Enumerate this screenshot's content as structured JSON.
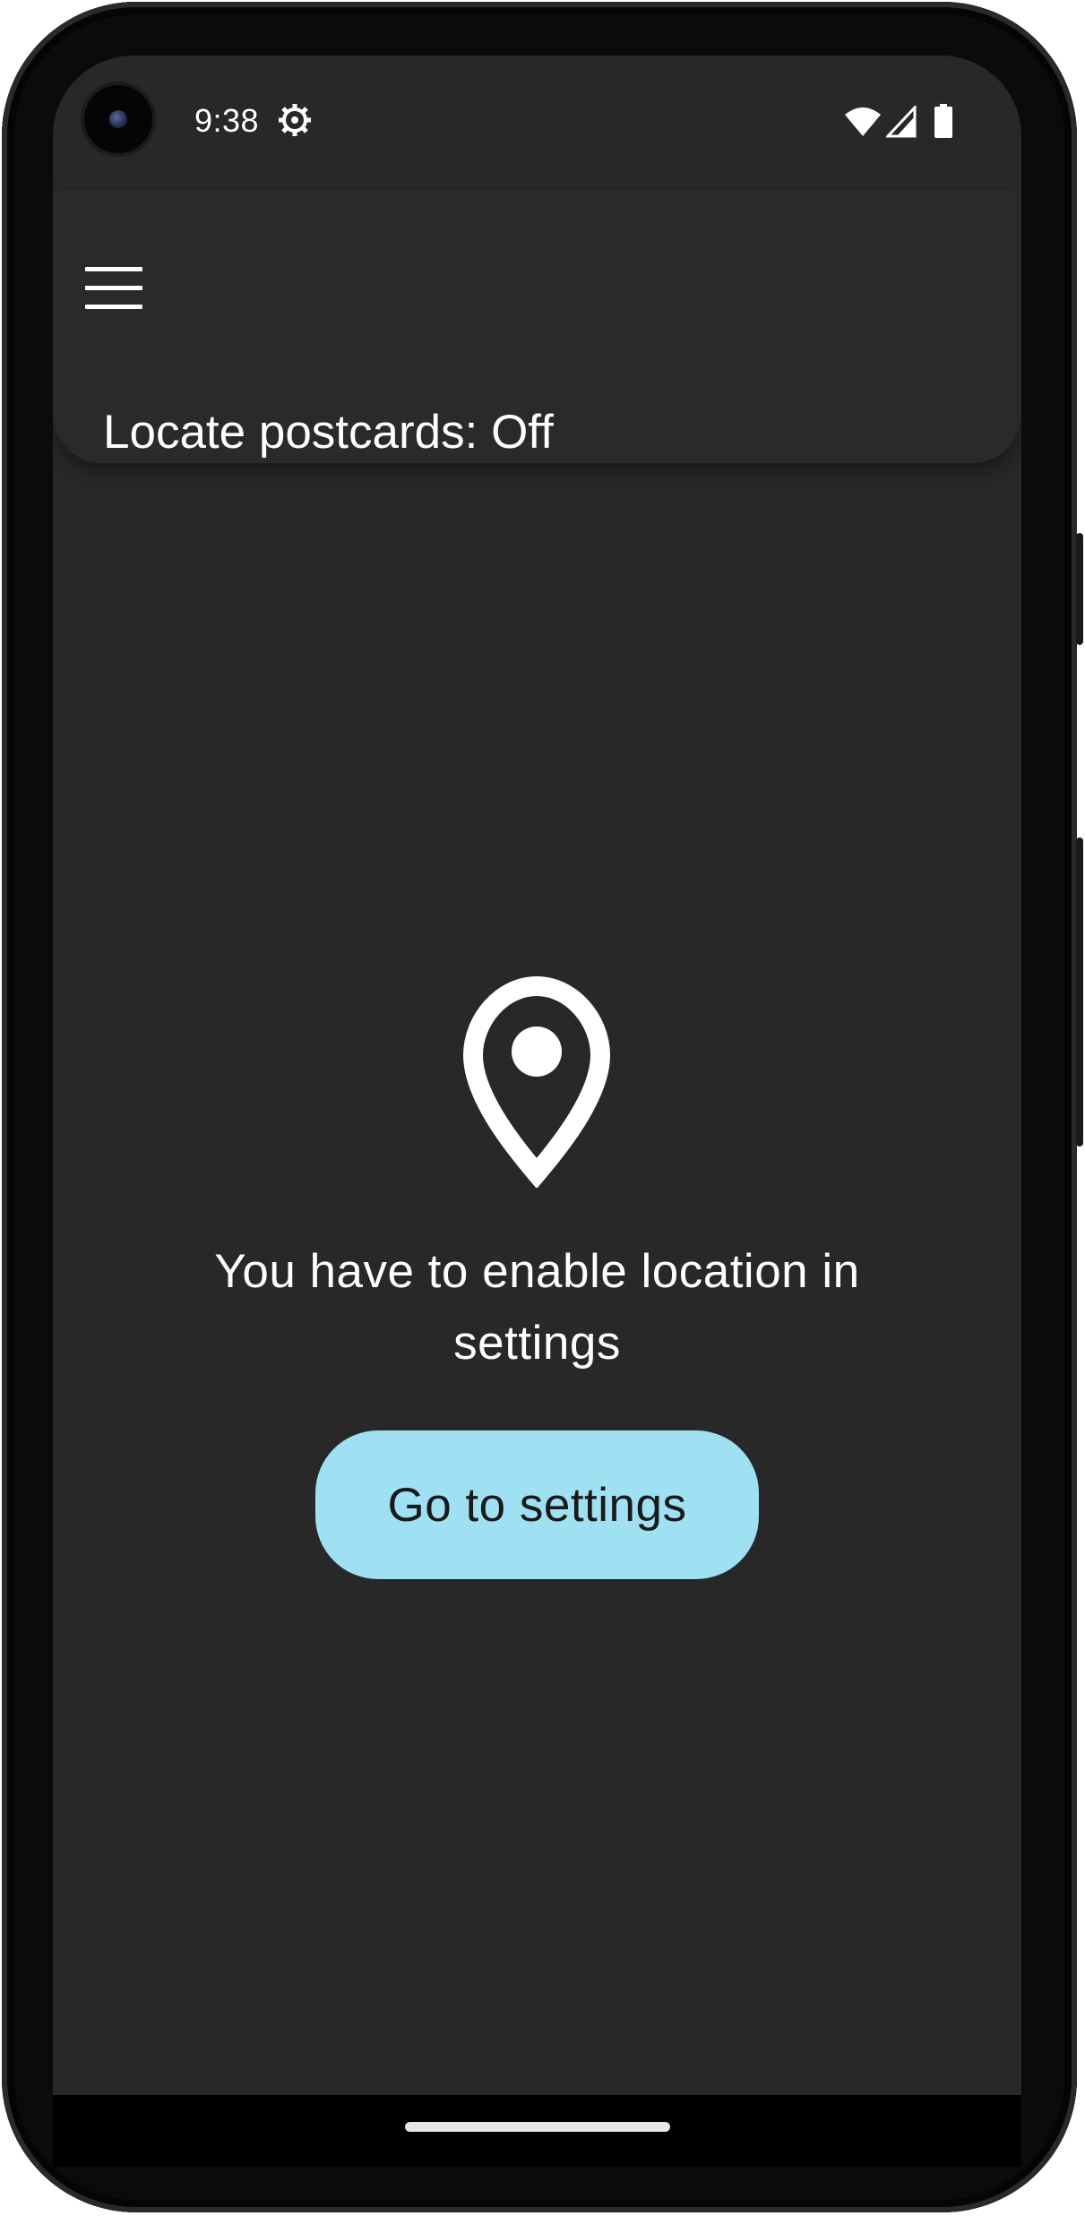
{
  "status_bar": {
    "time": "9:38",
    "icons": [
      "gear-icon",
      "wifi-icon",
      "signal-icon",
      "battery-icon"
    ]
  },
  "app_bar": {
    "menu_icon": "menu-icon",
    "title": "Locate postcards: Off"
  },
  "empty_state": {
    "icon": "location-pin-icon",
    "message": "You have to enable location in settings",
    "button_label": "Go to settings"
  },
  "colors": {
    "background": "#282828",
    "app_bar": "#2a2a2a",
    "button": "#9fe1f3",
    "text": "#ffffff"
  }
}
